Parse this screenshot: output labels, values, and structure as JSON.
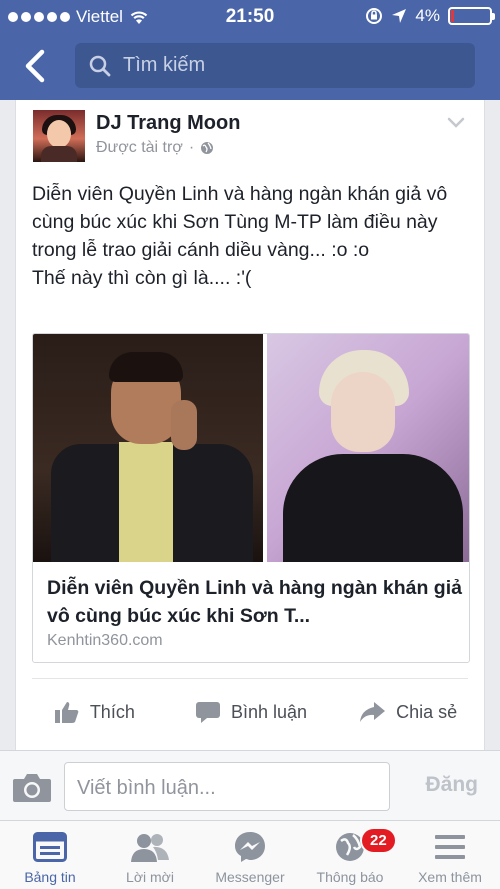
{
  "status_bar": {
    "carrier": "Viettel",
    "time": "21:50",
    "battery_percent": "4%",
    "battery_level": 0.04
  },
  "nav": {
    "search_placeholder": "Tìm kiếm"
  },
  "post": {
    "author": "DJ Trang Moon",
    "sponsored_label": "Được tài trợ",
    "sponsored_separator": "·",
    "text_line1": "Diễn viên Quyền Linh và hàng ngàn khán giả vô cùng búc xúc khi Sơn Tùng M-TP làm điều này trong lễ trao giải cánh diều vàng... :o :o",
    "text_line2": "Thế này thì còn gì là.... :'(",
    "link": {
      "title": "Diễn viên Quyền Linh và hàng ngàn khán giả vô cùng búc xúc khi Sơn T...",
      "domain": "Kenhtin360.com"
    },
    "actions": {
      "like": "Thích",
      "comment": "Bình luận",
      "share": "Chia sẻ"
    }
  },
  "comment_bar": {
    "placeholder": "Viết bình luận...",
    "post_label": "Đăng"
  },
  "tabs": [
    {
      "label": "Bảng tin",
      "icon": "news-feed-icon",
      "active": true
    },
    {
      "label": "Lời mời",
      "icon": "friend-requests-icon"
    },
    {
      "label": "Messenger",
      "icon": "messenger-icon"
    },
    {
      "label": "Thông báo",
      "icon": "globe-icon",
      "badge": "22"
    },
    {
      "label": "Xem thêm",
      "icon": "menu-icon"
    }
  ],
  "colors": {
    "brand": "#4a66a8",
    "badge": "#e31b23",
    "battery_low": "#e0383b"
  }
}
